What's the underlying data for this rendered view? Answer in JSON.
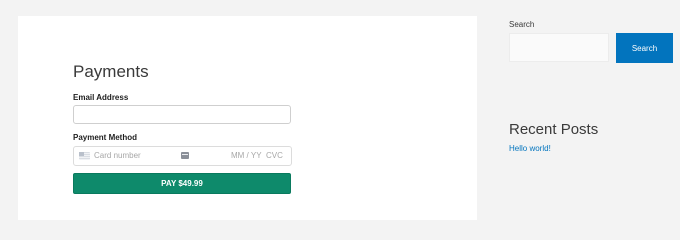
{
  "main": {
    "title": "Payments",
    "email_label": "Email Address",
    "email_value": "",
    "payment_method_label": "Payment Method",
    "card": {
      "number_placeholder": "Card number",
      "expiry_placeholder": "MM / YY",
      "cvc_placeholder": "CVC"
    },
    "pay_button_label": "PAY $49.99"
  },
  "sidebar": {
    "search_label": "Search",
    "search_value": "",
    "search_button_label": "Search",
    "recent_posts_title": "Recent Posts",
    "recent_posts": [
      "Hello world!"
    ]
  },
  "colors": {
    "pay_button": "#0e8a6b",
    "search_button": "#0274be",
    "link": "#0274be"
  }
}
